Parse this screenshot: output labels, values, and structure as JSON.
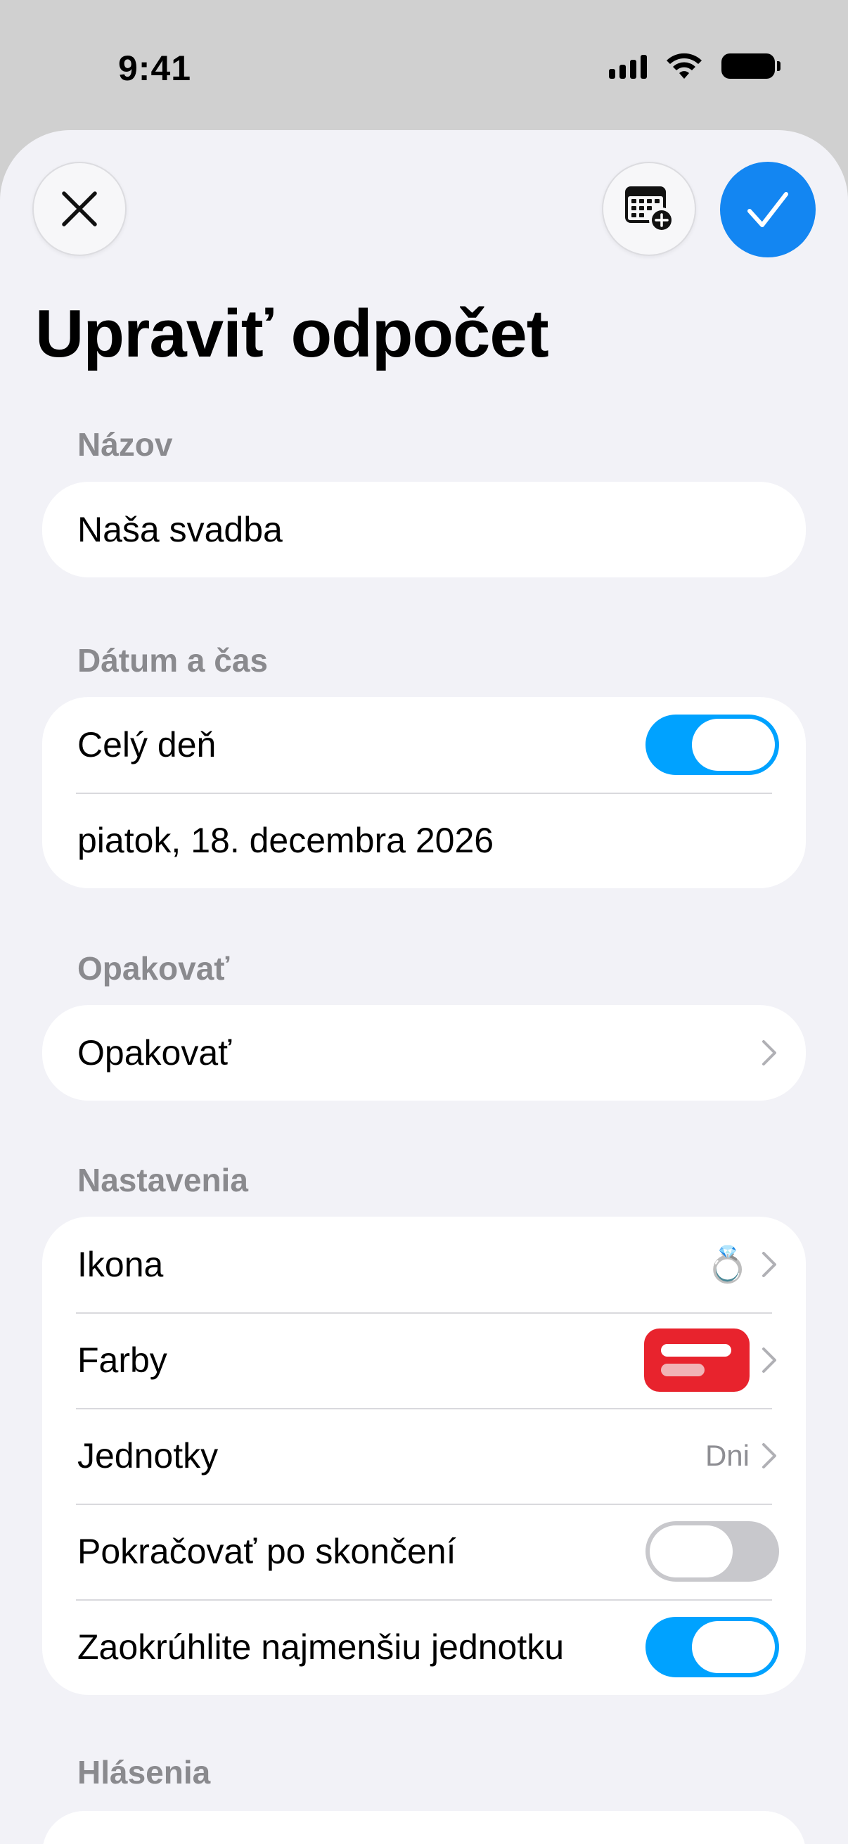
{
  "status_bar": {
    "time": "9:41"
  },
  "toolbar": {
    "close_icon": "xmark-icon",
    "calendar_icon": "calendar-badge-plus-icon",
    "confirm_icon": "checkmark-icon",
    "accent_color": "#1386f2"
  },
  "title": "Upraviť odpočet",
  "name_section": {
    "label": "Názov",
    "value": "Naša svadba"
  },
  "date_section": {
    "label": "Dátum a čas",
    "all_day_label": "Celý deň",
    "all_day_on": true,
    "date_value": "piatok, 18. decembra 2026"
  },
  "repeat_section": {
    "label": "Opakovať",
    "row_label": "Opakovať"
  },
  "settings_section": {
    "label": "Nastavenia",
    "icon_label": "Ikona",
    "icon_value": "💍",
    "colors_label": "Farby",
    "colors_value": "#e8232d",
    "units_label": "Jednotky",
    "units_value": "Dni",
    "continue_label": "Pokračovať po skončení",
    "continue_on": false,
    "round_label": "Zaokrúhlite najmenšiu jednotku",
    "round_on": true
  },
  "notifications_section": {
    "label": "Hlásenia"
  },
  "toggle_on_color": "#00a2ff"
}
